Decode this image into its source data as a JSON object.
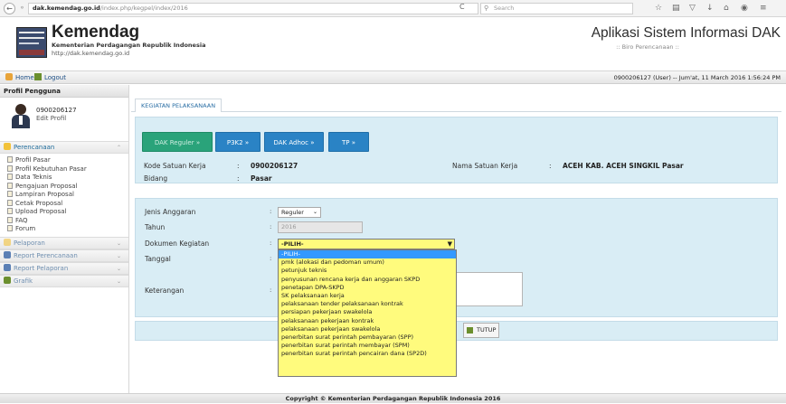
{
  "browser": {
    "url_domain": "dak.kemendag.go.id",
    "url_path": "/index.php/kegpel/index/2016",
    "search_placeholder": "Search",
    "back_icon": "back-arrow-icon",
    "reload_symbol": "C"
  },
  "header": {
    "brand": "Kemendag",
    "brand_sub": "Kementerian Perdagangan Republik Indonesia",
    "brand_url": "http://dak.kemendag.go.id",
    "app_title": "Aplikasi Sistem Informasi DAK",
    "app_sub": ":: Biro Perencanaan ::"
  },
  "topnav": {
    "home": "Home",
    "logout": "Logout",
    "user_info": "0900206127 (User) -- Jum'at, 11 March 2016 1:56:24 PM"
  },
  "sidebar": {
    "title": "Profil Pengguna",
    "profile_id": "0900206127",
    "edit_profile": "Edit Profil",
    "sections": {
      "perencanaan": "Perencanaan",
      "pelaporan": "Pelaporan",
      "report_perencanaan": "Report Perencanaan",
      "report_pelaporan": "Report Pelaporan",
      "grafik": "Grafik"
    },
    "perencanaan_items": [
      "Profil Pasar",
      "Profil Kebutuhan Pasar",
      "Data Teknis",
      "Pengajuan Proposal",
      "Lampiran Proposal",
      "Cetak Proposal",
      "Upload Proposal",
      "FAQ",
      "Forum"
    ]
  },
  "main": {
    "tab": "KEGIATAN PELAKSANAAN",
    "buttons": {
      "dak_reguler": "DAK Reguler »",
      "p3k2": "P3K2 »",
      "dak_adhoc": "DAK Adhoc »",
      "tp": "TP »"
    },
    "info": {
      "kode_label": "Kode Satuan Kerja",
      "kode_value": "0900206127",
      "bidang_label": "Bidang",
      "bidang_value": "Pasar",
      "nama_label": "Nama Satuan Kerja",
      "nama_value": "ACEH KAB. ACEH SINGKIL Pasar",
      "colon": ":"
    },
    "form": {
      "jenis_label": "Jenis Anggaran",
      "jenis_value": "Reguler",
      "tahun_label": "Tahun",
      "tahun_value": "2016",
      "dokumen_label": "Dokumen Kegiatan",
      "dokumen_value": "-PILIH-",
      "tanggal_label": "Tanggal",
      "keterangan_label": "Keterangan",
      "colon": ":"
    },
    "tutup_label": "TUTUP",
    "dropdown_options": [
      "-PILIH-",
      "pmk (alokasi dan pedoman umum)",
      "petunjuk teknis",
      "penyusunan rencana kerja dan anggaran SKPD",
      "penetapan DPA-SKPD",
      "SK pelaksanaan kerja",
      "pelaksanaan tender pelaksanaan kontrak",
      "persiapan pekerjaan swakelola",
      "pelaksanaan pekerjaan kontrak",
      "pelaksanaan pekerjaan swakelola",
      "penerbitan surat perintah pembayaran (SPP)",
      "penerbitan surat perintah membayar (SPM)",
      "penerbitan surat perintah pencairan dana (SP2D)"
    ]
  },
  "footer": "Copyright © Kementerian Perdagangan Republik Indonesia 2016",
  "colors": {
    "panel_bg": "#d9edf5",
    "btn_green": "#2aa37a",
    "btn_blue": "#2a83c5",
    "dropdown_bg": "#fffb7d",
    "dropdown_highlight": "#3399ff"
  }
}
